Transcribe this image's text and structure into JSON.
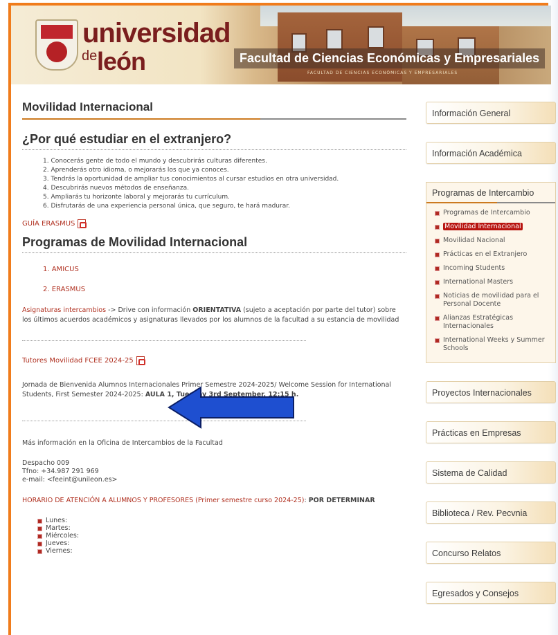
{
  "header": {
    "logo_line1": "universidad",
    "logo_de": "de",
    "logo_line2": "león",
    "faculty": "Facultad de Ciencias Económicas y Empresariales",
    "plaque": "FACULTAD DE CIENCIAS ECONÓMICAS Y EMPRESARIALES"
  },
  "main": {
    "title": "Movilidad Internacional",
    "why_heading": "¿Por qué estudiar en el extranjero?",
    "reasons": [
      "1. Conocerás gente de todo el mundo y descubrirás culturas diferentes.",
      "2. Aprenderás otro idioma, o mejorarás los que ya conoces.",
      "3. Tendrás la oportunidad de ampliar tus conocimientos al cursar estudios en otra universidad.",
      "4. Descubrirás nuevos métodos de enseñanza.",
      "5. Ampliarás tu horizonte laboral y mejorarás tu currículum.",
      "6. Disfrutarás de una experiencia personal única, que seguro, te hará madurar."
    ],
    "guide_link": "GUÍA ERASMUS",
    "programs_heading": "Programas de Movilidad Internacional",
    "programs": [
      "1. AMICUS",
      "2. ERASMUS"
    ],
    "asig_link": "Asignaturas intercambios",
    "asig_text_pre": " -> Drive con información ",
    "asig_bold": "ORIENTATIVA",
    "asig_text_post": " (sujeto a aceptación por parte del tutor) sobre los últimos acuerdos académicos y asignaturas llevados por los alumnos de la facultad a su estancia de movilidad",
    "tutores_link": "Tutores Movilidad FCEE 2024-25",
    "jornada_text": "Jornada de Bienvenida Alumnos Internacionales Primer Semestre 2024-2025/ Welcome Session for International Students, First Semester 2024-2025: ",
    "jornada_bold": "AULA 1, Tuesday 3rd September, 12:15 h.",
    "info": "Más información en la Oficina de Intercambios de la Facultad",
    "contact": [
      "Despacho 009",
      "Tfno: +34.987 291 969",
      "e-mail: <feeint@unileon.es>"
    ],
    "horario_link": "HORARIO DE ATENCIÓN A ALUMNOS Y PROFESORES (Primer semestre curso 2024-25)",
    "horario_sep": ": ",
    "horario_bold": "POR DETERMINAR",
    "days": [
      "Lunes:",
      "Martes:",
      "Miércoles:",
      "Jueves:",
      "Viernes:"
    ]
  },
  "sidebar": {
    "top_items": [
      "Información General",
      "Información Académica"
    ],
    "expanded_title": "Programas de Intercambio",
    "sub_items": [
      "Programas de Intercambio",
      "Movilidad Internacional",
      "Movilidad Nacional",
      "Prácticas en el Extranjero",
      "Incoming Students",
      "International Masters",
      "Noticias de movilidad para el Personal Docente",
      "Alianzas Estratégicas Internacionales",
      "International Weeks y Summer Schools"
    ],
    "bottom_items": [
      "Proyectos Internacionales",
      "Prácticas en Empresas",
      "Sistema de Calidad",
      "Biblioteca / Rev. Pecvnia",
      "Concurso Relatos",
      "Egresados y Consejos"
    ]
  },
  "colors": {
    "accent": "#f07c1c",
    "link": "#b03020",
    "active_bg": "#b8140f",
    "arrow": "#1e4fd0"
  }
}
